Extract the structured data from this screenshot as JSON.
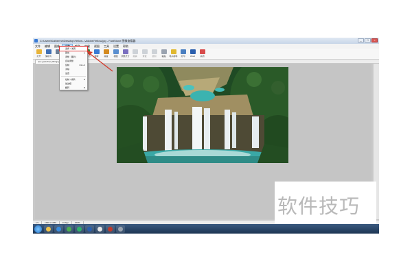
{
  "window": {
    "title": "C:\\Users\\Katherine\\Desktop\\Yellow...\\Adobe\\Yellow.jpg - FastStone 图像查看器"
  },
  "menubar": {
    "items": [
      "文件",
      "编辑",
      "图像",
      "调整",
      "颜色",
      "效果",
      "视图",
      "工具",
      "设置",
      "帮助"
    ],
    "active_index": 3
  },
  "toolbar": {
    "tools": [
      {
        "label": "打开",
        "icon": "folder-icon",
        "color": "#e8b43a",
        "disabled": false
      },
      {
        "label": "保存为",
        "icon": "save-icon",
        "color": "#3f6fb5",
        "disabled": false
      },
      {
        "label": "",
        "icon": "print-icon",
        "color": "#6b7f99",
        "disabled": false
      },
      {
        "label": "",
        "icon": "copy-icon",
        "color": "#8aa6c9",
        "disabled": false
      },
      {
        "label": "",
        "icon": "paste-icon",
        "color": "#c9a45a",
        "disabled": false
      },
      {
        "label": "调整大小",
        "icon": "resize-icon",
        "color": "#4a9a4a",
        "disabled": false
      },
      {
        "label": "旋转",
        "icon": "rotate-icon",
        "color": "#3a7bd5",
        "disabled": false
      },
      {
        "label": "亮度",
        "icon": "brightness-icon",
        "color": "#d48a1e",
        "disabled": false
      },
      {
        "label": "视图",
        "icon": "view-icon",
        "color": "#5a8fd0",
        "disabled": false
      },
      {
        "label": "调整尺寸",
        "icon": "canvas-size-icon",
        "color": "#7a6fc0",
        "disabled": false
      },
      {
        "label": "撤销",
        "icon": "undo-icon",
        "color": "#9aa3b0",
        "disabled": true
      },
      {
        "label": "重做",
        "icon": "redo-icon",
        "color": "#9aa3b0",
        "disabled": true
      },
      {
        "label": "复制",
        "icon": "copy2-icon",
        "color": "#9aa3b0",
        "disabled": true
      },
      {
        "label": "粘贴",
        "icon": "paste2-icon",
        "color": "#9aa3b0",
        "disabled": false
      },
      {
        "label": "电子邮件",
        "icon": "email-icon",
        "color": "#e0b830",
        "disabled": false
      },
      {
        "label": "打印",
        "icon": "printer-icon",
        "color": "#4a7fc0",
        "disabled": false
      },
      {
        "label": "Word",
        "icon": "word-icon",
        "color": "#2b5fad",
        "disabled": false
      },
      {
        "label": "关闭",
        "icon": "exit-icon",
        "color": "#d84b4b",
        "disabled": false
      }
    ]
  },
  "tab": {
    "label": "pwc-gankzhao-j002.jpg  (x)"
  },
  "dropdown": {
    "items": [
      {
        "label": "选择 > 矩形",
        "shortcut": "",
        "highlighted": true
      },
      {
        "label": "裁剪",
        "shortcut": "▸",
        "highlighted": false
      },
      {
        "label": "调整（图片）",
        "shortcut": "",
        "highlighted": false
      },
      {
        "label": "自动调整",
        "shortcut": "",
        "highlighted": false
      },
      {
        "label": "复制",
        "shortcut": "Ctrl+C",
        "highlighted": false
      },
      {
        "label": "清除",
        "shortcut": "",
        "highlighted": false
      },
      {
        "label": "设置",
        "shortcut": "",
        "highlighted": false
      },
      {
        "label": "绘制 / 涂鸦",
        "shortcut": "D",
        "highlighted": false
      },
      {
        "label": "加边框",
        "shortcut": "",
        "highlighted": false
      },
      {
        "label": "翻转",
        "shortcut": "R",
        "highlighted": false
      }
    ]
  },
  "statusbar": {
    "cells": [
      "1/1",
      "1920 x 1080",
      "24 bpp",
      "100%"
    ]
  },
  "taskbar": {
    "items": [
      {
        "icon": "explorer-icon",
        "color": "#f0c24a"
      },
      {
        "icon": "ie-icon",
        "color": "#3a8de0"
      },
      {
        "icon": "chrome-icon",
        "color": "#4caf50"
      },
      {
        "icon": "360-icon",
        "color": "#2fb36b"
      },
      {
        "icon": "word-icon",
        "color": "#2b5fad"
      },
      {
        "icon": "camera-icon",
        "color": "#e6e6e6"
      },
      {
        "icon": "faststone-icon",
        "color": "#c0392b"
      },
      {
        "icon": "settings-icon",
        "color": "#9aa3b0"
      }
    ]
  },
  "watermark": {
    "text": "软件技巧"
  },
  "colors": {
    "accent": "#d33a2c"
  }
}
